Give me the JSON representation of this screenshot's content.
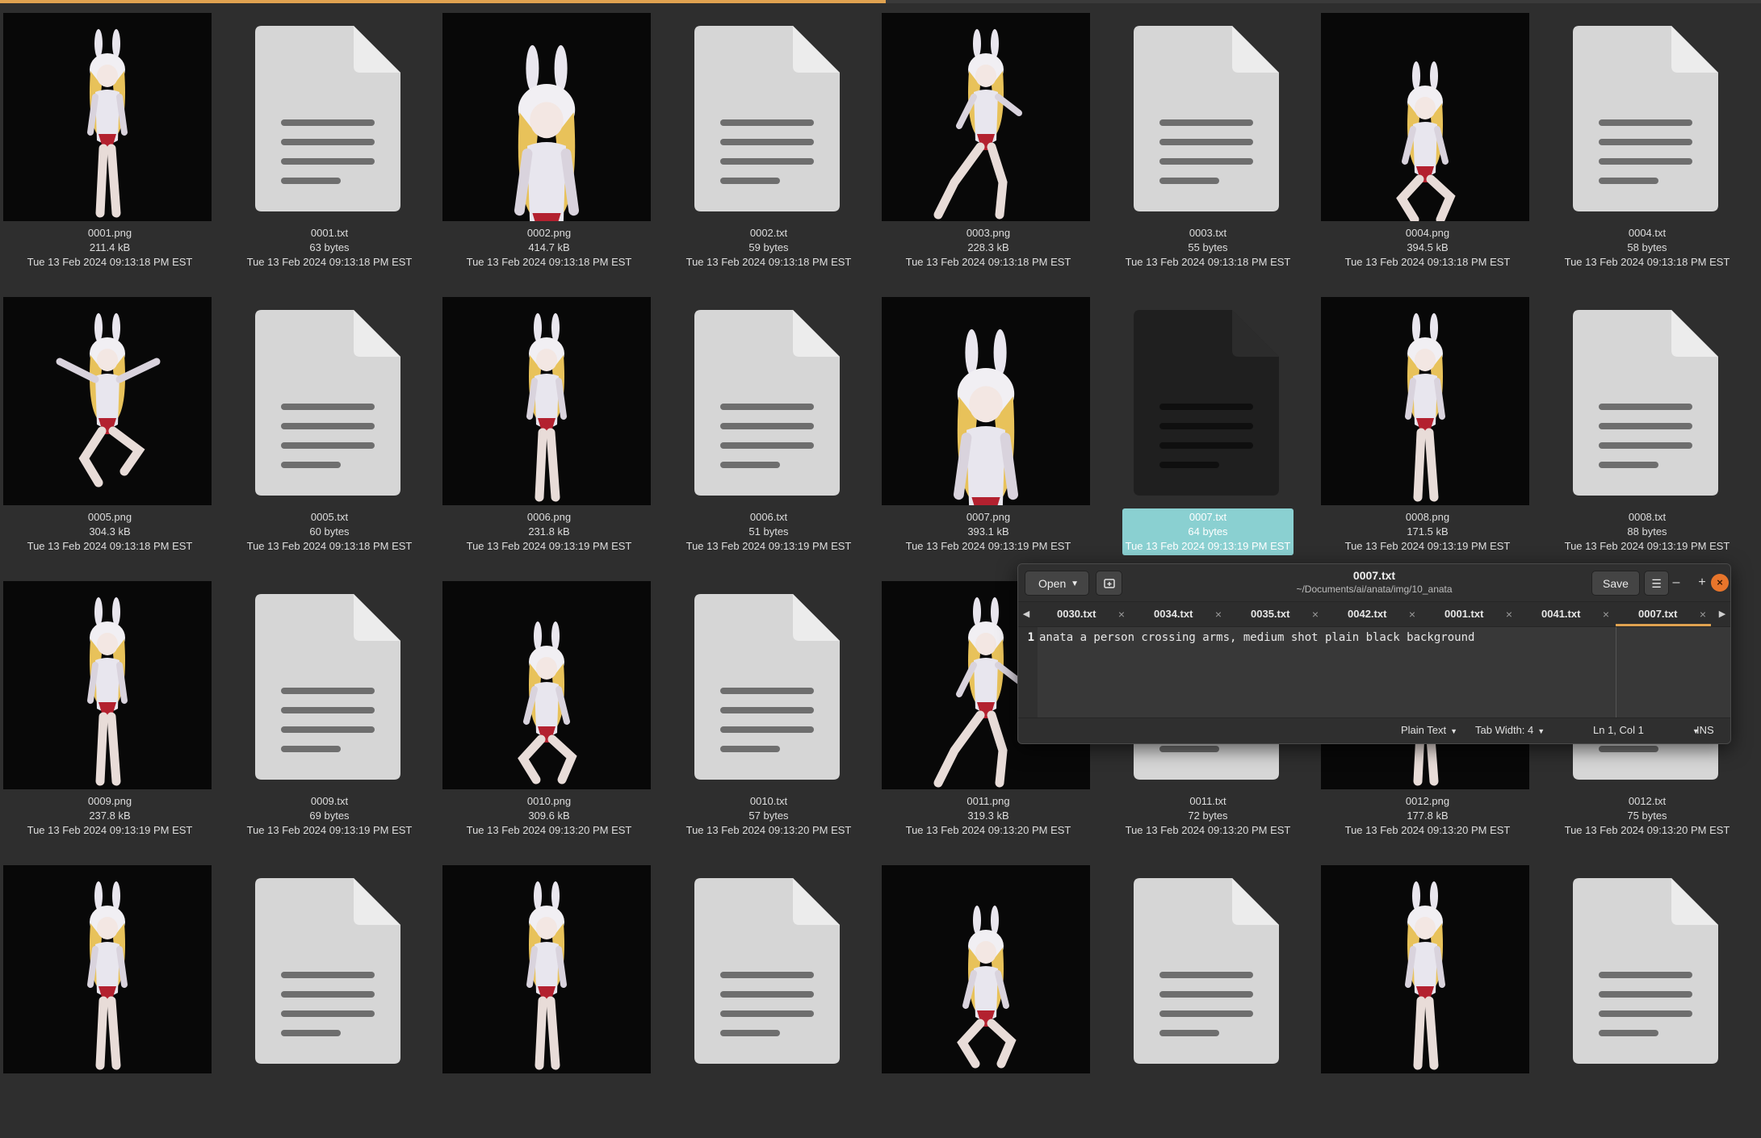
{
  "colors": {
    "background": "#2e2e2e",
    "selection": "#8ad0d1",
    "accent": "#e0a250",
    "close_button": "#e8752b"
  },
  "progress": {
    "fraction": 0.503
  },
  "files": [
    {
      "name": "0001.png",
      "size": "211.4 kB",
      "date": "Tue 13 Feb 2024 09:13:18 PM EST",
      "kind": "image",
      "pose": "stand"
    },
    {
      "name": "0001.txt",
      "size": "63 bytes",
      "date": "Tue 13 Feb 2024 09:13:18 PM EST",
      "kind": "text"
    },
    {
      "name": "0002.png",
      "size": "414.7 kB",
      "date": "Tue 13 Feb 2024 09:13:18 PM EST",
      "kind": "image",
      "pose": "closeup"
    },
    {
      "name": "0002.txt",
      "size": "59 bytes",
      "date": "Tue 13 Feb 2024 09:13:18 PM EST",
      "kind": "text"
    },
    {
      "name": "0003.png",
      "size": "228.3 kB",
      "date": "Tue 13 Feb 2024 09:13:18 PM EST",
      "kind": "image",
      "pose": "lunge"
    },
    {
      "name": "0003.txt",
      "size": "55 bytes",
      "date": "Tue 13 Feb 2024 09:13:18 PM EST",
      "kind": "text"
    },
    {
      "name": "0004.png",
      "size": "394.5 kB",
      "date": "Tue 13 Feb 2024 09:13:18 PM EST",
      "kind": "image",
      "pose": "sit"
    },
    {
      "name": "0004.txt",
      "size": "58 bytes",
      "date": "Tue 13 Feb 2024 09:13:18 PM EST",
      "kind": "text"
    },
    {
      "name": "0005.png",
      "size": "304.3 kB",
      "date": "Tue 13 Feb 2024 09:13:18 PM EST",
      "kind": "image",
      "pose": "jump"
    },
    {
      "name": "0005.txt",
      "size": "60 bytes",
      "date": "Tue 13 Feb 2024 09:13:18 PM EST",
      "kind": "text"
    },
    {
      "name": "0006.png",
      "size": "231.8 kB",
      "date": "Tue 13 Feb 2024 09:13:19 PM EST",
      "kind": "image",
      "pose": "stand"
    },
    {
      "name": "0006.txt",
      "size": "51 bytes",
      "date": "Tue 13 Feb 2024 09:13:19 PM EST",
      "kind": "text"
    },
    {
      "name": "0007.png",
      "size": "393.1 kB",
      "date": "Tue 13 Feb 2024 09:13:19 PM EST",
      "kind": "image",
      "pose": "closeup"
    },
    {
      "name": "0007.txt",
      "size": "64 bytes",
      "date": "Tue 13 Feb 2024 09:13:19 PM EST",
      "kind": "text",
      "selected": true
    },
    {
      "name": "0008.png",
      "size": "171.5 kB",
      "date": "Tue 13 Feb 2024 09:13:19 PM EST",
      "kind": "image",
      "pose": "stand"
    },
    {
      "name": "0008.txt",
      "size": "88 bytes",
      "date": "Tue 13 Feb 2024 09:13:19 PM EST",
      "kind": "text"
    },
    {
      "name": "0009.png",
      "size": "237.8 kB",
      "date": "Tue 13 Feb 2024 09:13:19 PM EST",
      "kind": "image",
      "pose": "stand"
    },
    {
      "name": "0009.txt",
      "size": "69 bytes",
      "date": "Tue 13 Feb 2024 09:13:19 PM EST",
      "kind": "text"
    },
    {
      "name": "0010.png",
      "size": "309.6 kB",
      "date": "Tue 13 Feb 2024 09:13:20 PM EST",
      "kind": "image",
      "pose": "crouch"
    },
    {
      "name": "0010.txt",
      "size": "57 bytes",
      "date": "Tue 13 Feb 2024 09:13:20 PM EST",
      "kind": "text"
    },
    {
      "name": "0011.png",
      "size": "319.3 kB",
      "date": "Tue 13 Feb 2024 09:13:20 PM EST",
      "kind": "image",
      "pose": "lunge"
    },
    {
      "name": "0011.txt",
      "size": "72 bytes",
      "date": "Tue 13 Feb 2024 09:13:20 PM EST",
      "kind": "text"
    },
    {
      "name": "0012.png",
      "size": "177.8 kB",
      "date": "Tue 13 Feb 2024 09:13:20 PM EST",
      "kind": "image",
      "pose": "stand"
    },
    {
      "name": "0012.txt",
      "size": "75 bytes",
      "date": "Tue 13 Feb 2024 09:13:20 PM EST",
      "kind": "text"
    },
    {
      "name": "",
      "size": "",
      "date": "",
      "kind": "image",
      "pose": "stand"
    },
    {
      "name": "",
      "size": "",
      "date": "",
      "kind": "text"
    },
    {
      "name": "",
      "size": "",
      "date": "",
      "kind": "image",
      "pose": "stand"
    },
    {
      "name": "",
      "size": "",
      "date": "",
      "kind": "text"
    },
    {
      "name": "",
      "size": "",
      "date": "",
      "kind": "image",
      "pose": "crouch"
    },
    {
      "name": "",
      "size": "",
      "date": "",
      "kind": "text"
    },
    {
      "name": "",
      "size": "",
      "date": "",
      "kind": "image",
      "pose": "stand"
    },
    {
      "name": "",
      "size": "",
      "date": "",
      "kind": "text"
    }
  ],
  "editor": {
    "title": "0007.txt",
    "path": "~/Documents/ai/anata/img/10_anata",
    "open_label": "Open",
    "save_label": "Save",
    "minimize_label": "–",
    "maximize_label": "+",
    "close_label": "×",
    "tabs": [
      "0030.txt",
      "0034.txt",
      "0035.txt",
      "0042.txt",
      "0001.txt",
      "0041.txt",
      "0007.txt"
    ],
    "active_tab": 6,
    "line_number": "1",
    "content": "anata a person crossing arms, medium shot plain black background",
    "status": {
      "language": "Plain Text",
      "tab_width": "Tab Width: 4",
      "position": "Ln 1, Col 1",
      "mode": "INS"
    }
  }
}
